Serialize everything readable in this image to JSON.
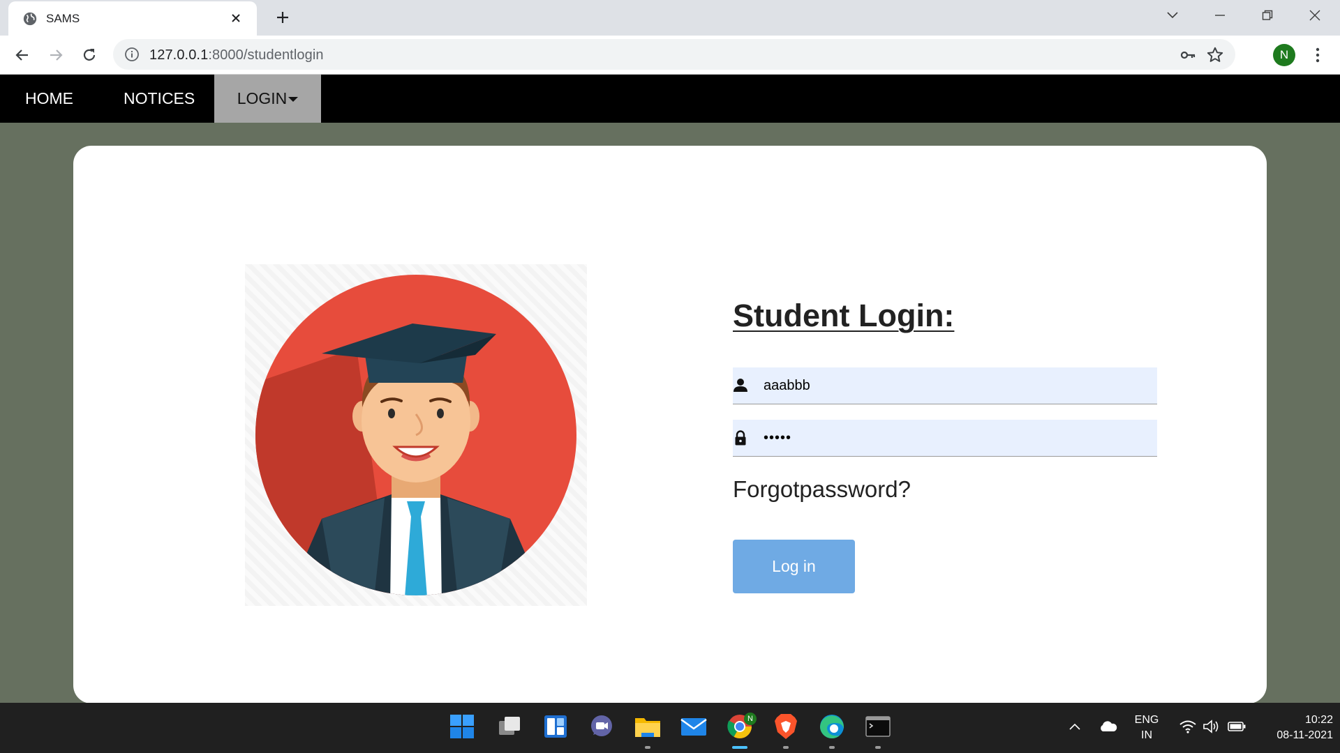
{
  "browser": {
    "tab_title": "SAMS",
    "url_host": "127.0.0.1",
    "url_path": ":8000/studentlogin",
    "profile_initial": "N"
  },
  "nav": {
    "home": "HOME",
    "notices": "NOTICES",
    "login": "LOGIN"
  },
  "login": {
    "title": "Student Login:",
    "username_value": "aaabbb",
    "password_value": "•••••",
    "forgot": "Forgotpassword?",
    "button": "Log in"
  },
  "taskbar": {
    "lang_top": "ENG",
    "lang_bottom": "IN",
    "time": "10:22",
    "date": "08-11-2021",
    "chrome_badge": "N"
  },
  "colors": {
    "page_bg": "#66705f",
    "nav_bg": "#000000",
    "nav_active": "#a6a6a6",
    "field_bg": "#e8f0fe",
    "button_bg": "#6faae4",
    "avatar_circle": "#e74c3c"
  }
}
